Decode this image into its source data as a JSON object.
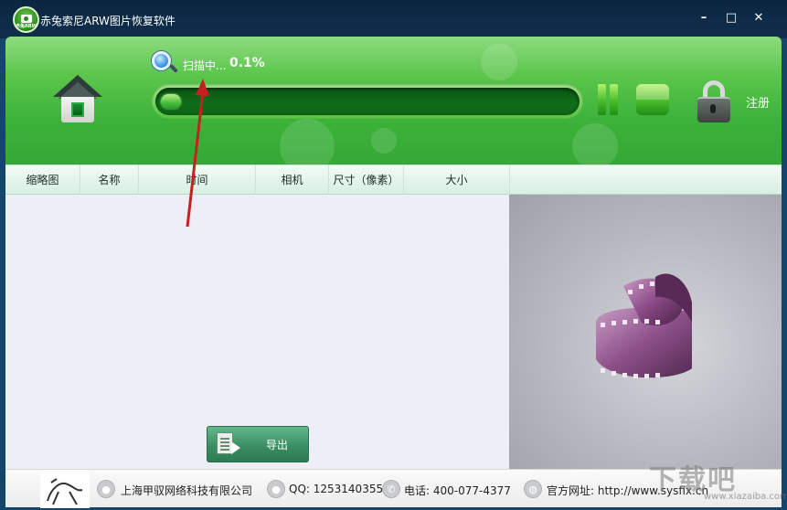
{
  "window": {
    "title": "赤兔索尼ARW图片恢复软件",
    "icon_text": "赤兔ARW",
    "minimize": "–",
    "maximize": "□",
    "close": "✕"
  },
  "header": {
    "scan_status": "扫描中...",
    "scan_percent": "0.1%",
    "progress_fraction": 0.01,
    "register_label": "注册",
    "accent_color": "#3cb23a"
  },
  "table": {
    "columns": [
      "缩略图",
      "名称",
      "时间",
      "相机",
      "尺寸（像素）",
      "大小"
    ]
  },
  "export_button": {
    "label": "导出"
  },
  "footer": {
    "company": "上海甲驭网络科技有限公司",
    "qq": "QQ: 1253140355",
    "phone": "电话: 400-077-4377",
    "website": "官方网址: http://www.sysfix.cn"
  },
  "watermark": {
    "text": "下载吧",
    "sub": "www.xiazaiba.com"
  },
  "icons": [
    "app-camera-icon",
    "minimize-icon",
    "maximize-icon",
    "close-icon",
    "home-icon",
    "magnifier-icon",
    "pause-icon",
    "stop-icon",
    "lock-icon",
    "export-icon",
    "company-icon",
    "qq-icon",
    "phone-icon",
    "globe-icon",
    "film-reel-icon"
  ]
}
